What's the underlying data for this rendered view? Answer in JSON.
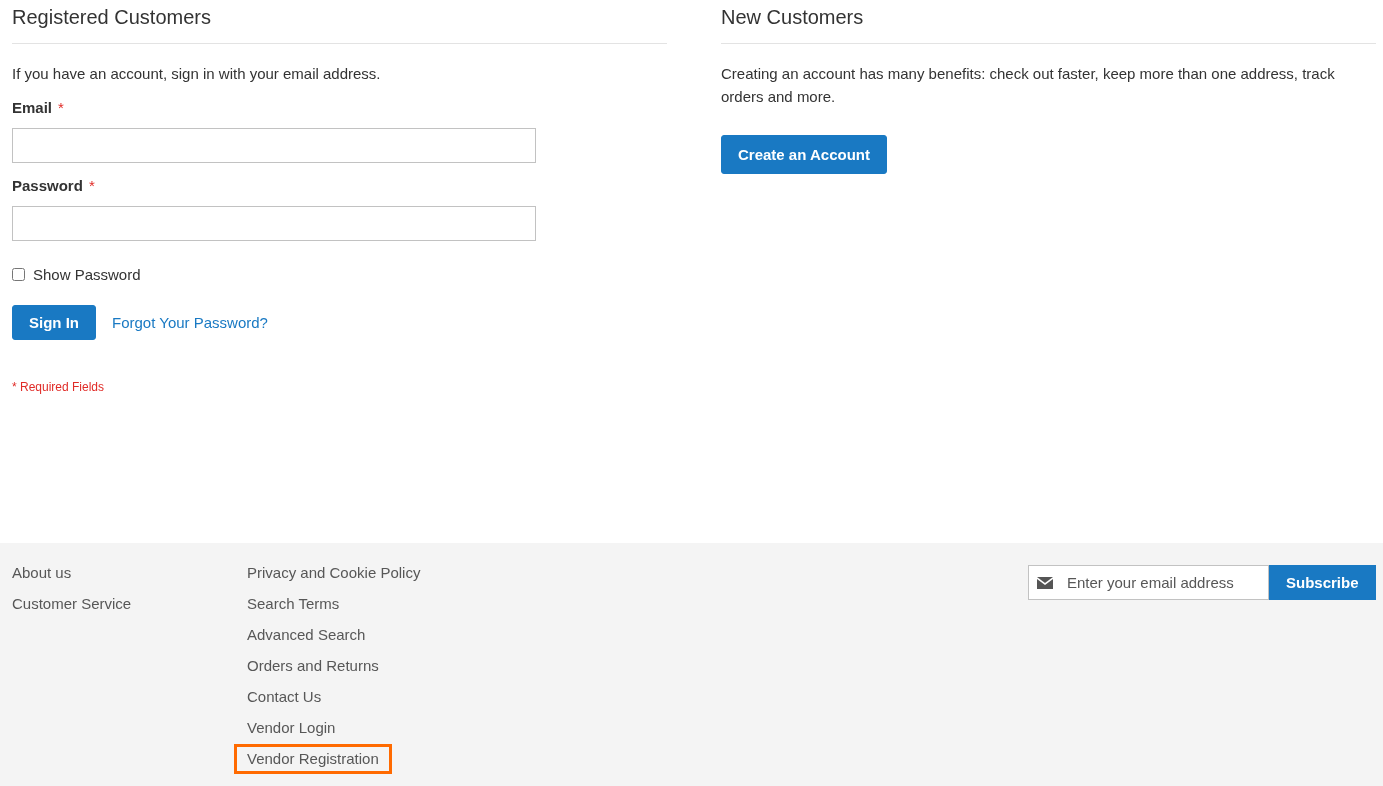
{
  "registered": {
    "title": "Registered Customers",
    "intro": "If you have an account, sign in with your email address.",
    "fields": [
      {
        "label": "Email",
        "required_mark": "*"
      },
      {
        "label": "Password",
        "required_mark": "*"
      }
    ],
    "show_password": {
      "label": "Show Password",
      "checked": false
    },
    "sign_in_button": "Sign In",
    "forgot_link": "Forgot Your Password?",
    "required_note": "* Required Fields"
  },
  "new_customers": {
    "title": "New Customers",
    "text": "Creating an account has many benefits: check out faster, keep more than one address, track orders and more.",
    "button": "Create an Account"
  },
  "footer": {
    "columns": [
      [
        {
          "label": "About us",
          "highlighted": false
        },
        {
          "label": "Customer Service",
          "highlighted": false
        }
      ],
      [
        {
          "label": "Privacy and Cookie Policy",
          "highlighted": false
        },
        {
          "label": "Search Terms",
          "highlighted": false
        },
        {
          "label": "Advanced Search",
          "highlighted": false
        },
        {
          "label": "Orders and Returns",
          "highlighted": false
        },
        {
          "label": "Contact Us",
          "highlighted": false
        },
        {
          "label": "Vendor Login",
          "highlighted": false
        },
        {
          "label": "Vendor Registration",
          "highlighted": true
        }
      ]
    ],
    "newsletter": {
      "placeholder": "Enter your email address",
      "button": "Subscribe"
    }
  }
}
